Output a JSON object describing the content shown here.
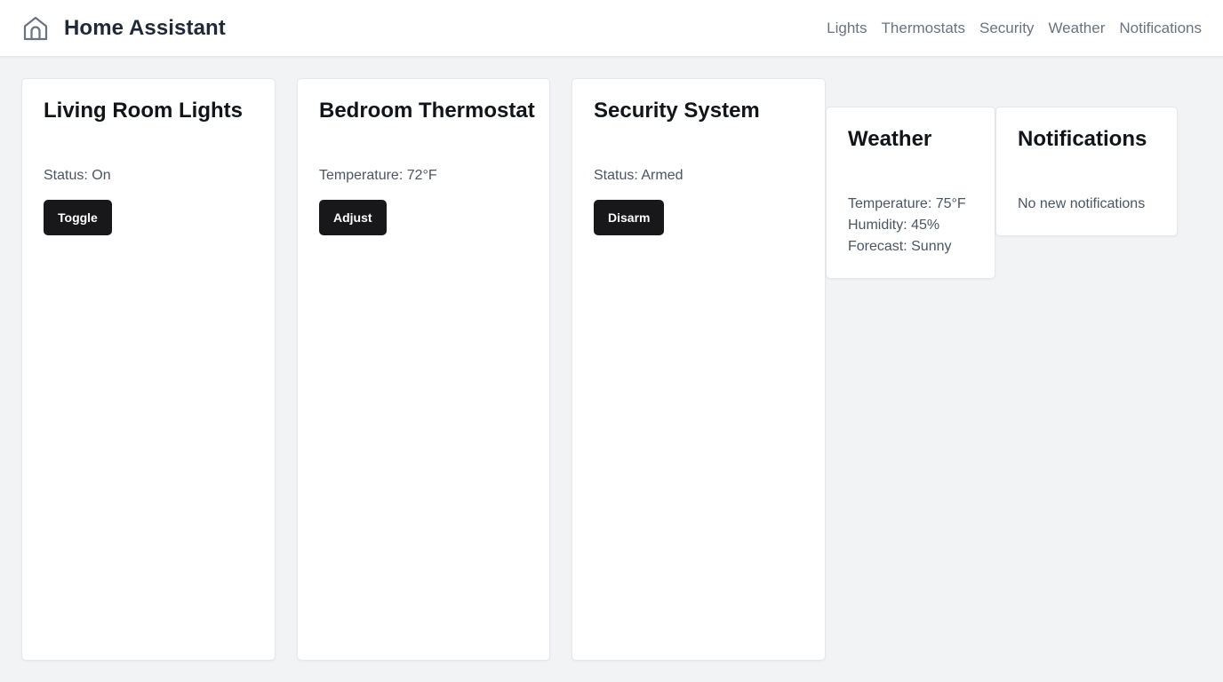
{
  "header": {
    "brand_icon": "home-icon",
    "title": "Home Assistant",
    "nav": [
      "Lights",
      "Thermostats",
      "Security",
      "Weather",
      "Notifications"
    ]
  },
  "cards": {
    "lights": {
      "title": "Living Room Lights",
      "status": "Status: On",
      "button": "Toggle"
    },
    "thermostat": {
      "title": "Bedroom Thermostat",
      "temperature": "Temperature: 72°F",
      "button": "Adjust"
    },
    "security": {
      "title": "Security System",
      "status": "Status: Armed",
      "button": "Disarm"
    },
    "weather": {
      "title": "Weather",
      "lines": [
        "Temperature: 75°F",
        "Humidity: 45%",
        "Forecast: Sunny"
      ]
    },
    "notifications": {
      "title": "Notifications",
      "message": "No new notifications"
    }
  },
  "colors": {
    "page_background": "#f2f3f5",
    "button_background": "#18181b",
    "nav_text": "#6b7280"
  }
}
